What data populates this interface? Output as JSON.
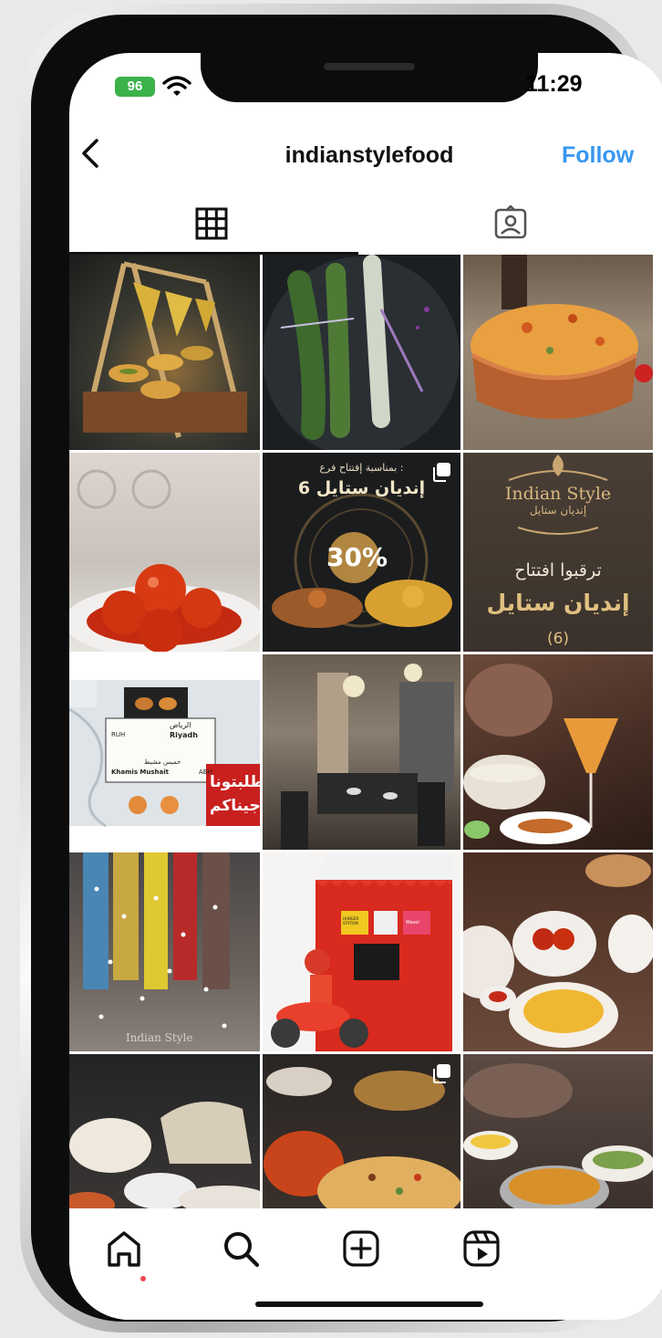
{
  "status_bar": {
    "battery": "96",
    "time": "11:29"
  },
  "header": {
    "username": "indianstylefood",
    "follow_label": "Follow"
  },
  "tabs": [
    {
      "icon": "grid-icon"
    },
    {
      "icon": "tagged-icon"
    }
  ],
  "grid": {
    "tiles": [
      {
        "desc": "snack-stand"
      },
      {
        "desc": "kebab-plate"
      },
      {
        "desc": "biryani-copper-pot"
      },
      {
        "desc": "gulab-jamun"
      },
      {
        "desc": "promo-opening",
        "ar_line1": "بمناسبة إفتتاح فرع :",
        "ar_line2": "إنديان ستايل 6",
        "percent": "30%",
        "multi": true
      },
      {
        "desc": "brand-opening",
        "brand_en": "Indian Style",
        "brand_ar": "إنديان ستايل",
        "ar_line1": "ترقبوا افتتاح",
        "ar_line2": "إنديان ستايل",
        "num": "(6)"
      },
      {
        "desc": "delivery-map",
        "top_ar": "الرياض",
        "top_en": "Riyadh",
        "code1": "RUH",
        "code2": "ABH",
        "bottom_en": "Khamis Mushait",
        "bottom_ar": "خميس مشيط",
        "side_ar1": "طلبتونا",
        "side_ar2": "وجيناكم"
      },
      {
        "desc": "restaurant-interior"
      },
      {
        "desc": "dessert-table"
      },
      {
        "desc": "colorful-lights",
        "brand_en": "Indian Style"
      },
      {
        "desc": "delivery-scooter",
        "sign1": "HUNGER STATION",
        "sign2": "Wasel"
      },
      {
        "desc": "table-spread"
      },
      {
        "desc": "bread-basket"
      },
      {
        "desc": "curry-biryani",
        "multi": true
      },
      {
        "desc": "dinner-spread"
      }
    ]
  },
  "bottom_nav": [
    {
      "icon": "home-icon",
      "active": true
    },
    {
      "icon": "search-icon"
    },
    {
      "icon": "add-post-icon"
    },
    {
      "icon": "reels-icon"
    }
  ],
  "colors": {
    "accent": "#3897f0",
    "battery": "#3bb34a",
    "notification_dot": "#ed4956"
  }
}
